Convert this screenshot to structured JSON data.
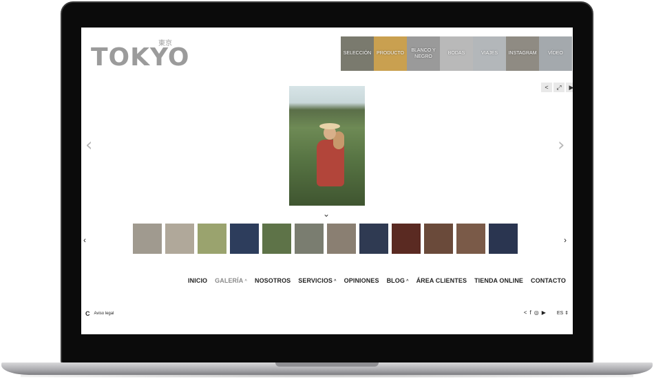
{
  "brand": {
    "logo_text": "TOKYO",
    "logo_sub": "東京"
  },
  "categories": [
    {
      "label": "SELECCIÓN",
      "color": "#7a7a6e"
    },
    {
      "label": "PRODUCTO",
      "color": "#c9a050"
    },
    {
      "label": "BLANCO Y NEGRO",
      "color": "#9a9a9a"
    },
    {
      "label": "BODAS",
      "color": "#b9b9b9"
    },
    {
      "label": "VIAJES",
      "color": "#b3b7ba"
    },
    {
      "label": "INSTAGRAM",
      "color": "#8f8b83"
    },
    {
      "label": "VÍDEO",
      "color": "#a4a9ad"
    }
  ],
  "player": {
    "share_icon": "<",
    "fullscreen_icon": "⤢",
    "play_icon": "▶"
  },
  "gallery": {
    "prev_arrow": "‹",
    "next_arrow": "›",
    "expand_arrow": "⌄",
    "thumb_prev": "‹",
    "thumb_next": "›"
  },
  "thumbnails": [
    {
      "color": "#a09a8f"
    },
    {
      "color": "#b0a89a"
    },
    {
      "color": "#9aa36e"
    },
    {
      "color": "#2d3d5c"
    },
    {
      "color": "#5e7348"
    },
    {
      "color": "#7a7d70"
    },
    {
      "color": "#8a7f72"
    },
    {
      "color": "#2f3a52"
    },
    {
      "color": "#5a2a22"
    },
    {
      "color": "#6a4a3a"
    },
    {
      "color": "#7a5a48"
    },
    {
      "color": "#2a3550"
    }
  ],
  "nav": {
    "items": [
      {
        "label": "INICIO",
        "caret": ""
      },
      {
        "label": "GALERÍA",
        "caret": "^"
      },
      {
        "label": "NOSOTROS",
        "caret": ""
      },
      {
        "label": "SERVICIOS",
        "caret": "^"
      },
      {
        "label": "OPINIONES",
        "caret": ""
      },
      {
        "label": "BLOG",
        "caret": "^"
      },
      {
        "label": "ÁREA CLIENTES",
        "caret": ""
      },
      {
        "label": "TIENDA ONLINE",
        "caret": ""
      },
      {
        "label": "CONTACTO",
        "caret": ""
      }
    ],
    "active_index": 1
  },
  "footer": {
    "logo": "C",
    "legal": "Aviso legal",
    "social": [
      "<",
      "f",
      "◎",
      "▶"
    ],
    "language": "ES ⇕"
  }
}
